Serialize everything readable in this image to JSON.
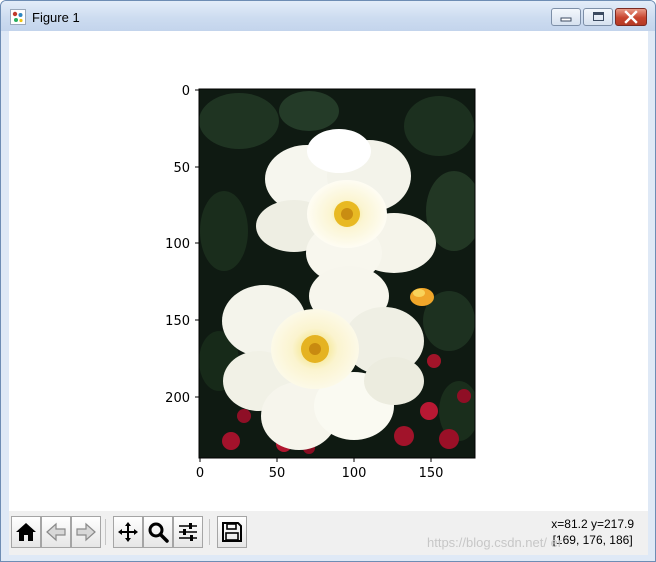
{
  "window": {
    "title": "Figure 1",
    "icons": {
      "app": "matplotlib-figure-icon",
      "minimize": "minimize-icon",
      "maximize": "maximize-icon",
      "close": "close-icon"
    }
  },
  "plot": {
    "image_description_icon": "flower-image",
    "x_ticks": [
      "0",
      "50",
      "100",
      "150"
    ],
    "y_ticks": [
      "0",
      "50",
      "100",
      "150",
      "200"
    ],
    "xlim": [
      0,
      179
    ],
    "ylim": [
      240,
      0
    ]
  },
  "toolbar": {
    "buttons": [
      {
        "name": "home",
        "icon": "home-icon"
      },
      {
        "name": "back",
        "icon": "back-arrow-icon"
      },
      {
        "name": "forward",
        "icon": "forward-arrow-icon"
      },
      {
        "name": "pan",
        "icon": "pan-icon"
      },
      {
        "name": "zoom",
        "icon": "zoom-icon"
      },
      {
        "name": "configure",
        "icon": "sliders-icon"
      },
      {
        "name": "save",
        "icon": "save-icon"
      }
    ],
    "coords_line1": "x=81.2 y=217.9",
    "coords_line2": "[169, 176, 186]",
    "watermark": "https://blog.csdn.net/      er"
  }
}
